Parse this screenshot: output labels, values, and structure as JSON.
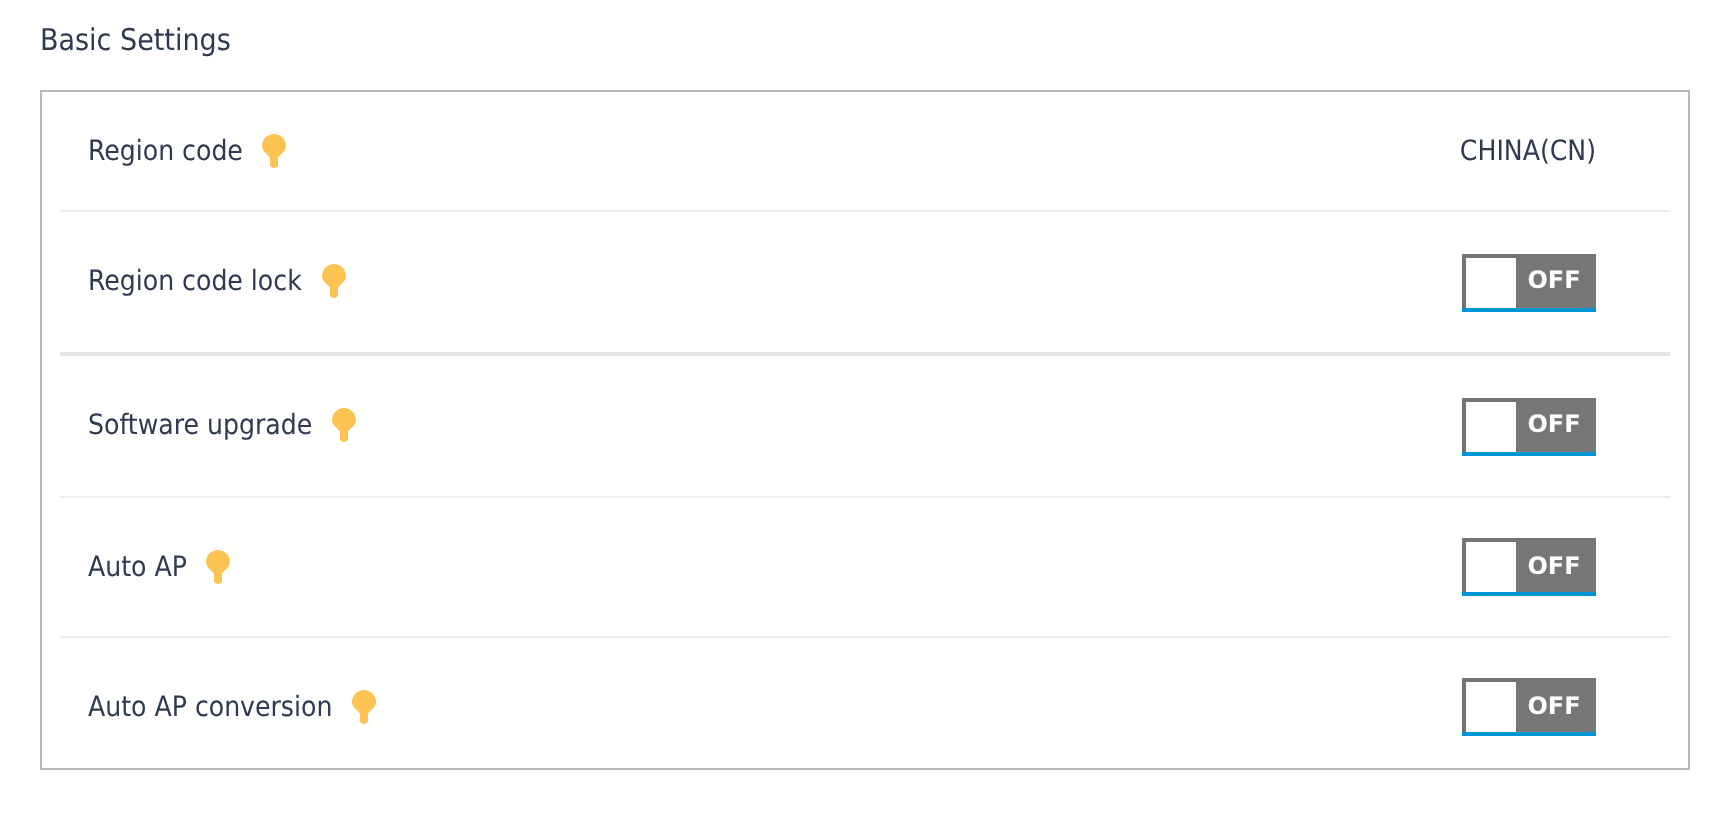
{
  "section_title": "Basic Settings",
  "groups": [
    {
      "rows": [
        {
          "kind": "text",
          "label": "Region code",
          "value": "CHINA(CN)"
        },
        {
          "kind": "toggle",
          "label": "Region code lock",
          "on": false,
          "state_text": "OFF"
        }
      ]
    },
    {
      "rows": [
        {
          "kind": "toggle",
          "label": "Software upgrade",
          "on": false,
          "state_text": "OFF"
        },
        {
          "kind": "toggle",
          "label": "Auto AP",
          "on": false,
          "state_text": "OFF"
        },
        {
          "kind": "toggle",
          "label": "Auto AP conversion",
          "on": false,
          "state_text": "OFF"
        }
      ]
    }
  ]
}
